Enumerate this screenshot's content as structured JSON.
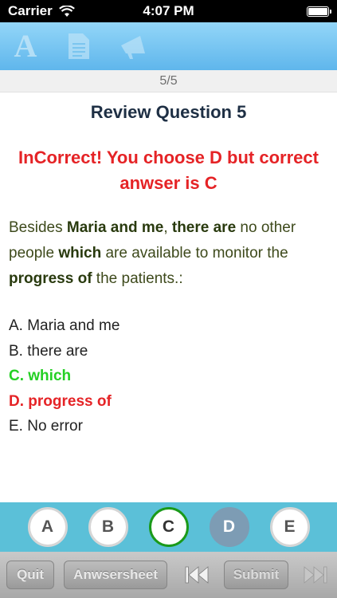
{
  "status_bar": {
    "carrier": "Carrier",
    "time": "4:07 PM"
  },
  "toolbar": {
    "font_icon_glyph": "A",
    "icons": [
      "font-icon",
      "document-icon",
      "megaphone-icon"
    ]
  },
  "counter": "5/5",
  "question": {
    "title": "Review Question 5",
    "result": "InCorrect! You choose D but correct anwser is C",
    "text_parts": [
      "Besides ",
      "Maria and me",
      ", ",
      "there are",
      " no other people ",
      "which",
      " are available to monitor the ",
      "progress of",
      " the patients.:"
    ],
    "options": [
      {
        "label": "A. Maria and me"
      },
      {
        "label": "B. there are"
      },
      {
        "label": "C. which"
      },
      {
        "label": "D. progress of"
      },
      {
        "label": "E. No error"
      }
    ]
  },
  "answer_buttons": [
    "A",
    "B",
    "C",
    "D",
    "E"
  ],
  "selected_answer": "D",
  "correct_answer": "C",
  "bottom_bar": {
    "quit": "Quit",
    "answersheet": "Anwsersheet",
    "submit": "Submit"
  },
  "colors": {
    "correct": "#24d024",
    "incorrect": "#e52326",
    "toolbar": "#5fb6ec",
    "answer_bar": "#5bc0d8",
    "selected": "#7d9cb4"
  }
}
